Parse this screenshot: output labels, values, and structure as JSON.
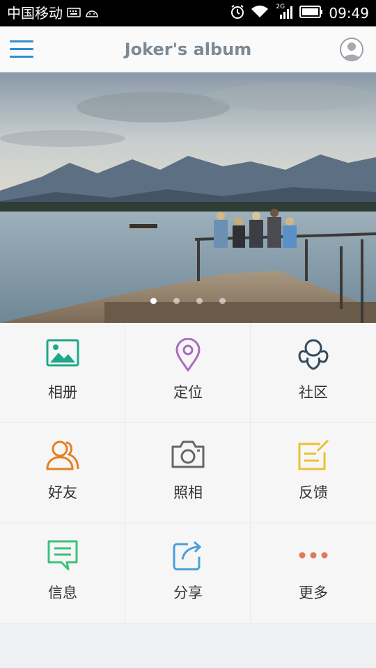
{
  "status_bar": {
    "carrier": "中国移动",
    "network": "2G",
    "time": "09:49"
  },
  "header": {
    "title": "Joker's album",
    "menu_icon": "hamburger-menu-icon",
    "avatar_icon": "user-avatar-icon"
  },
  "banner": {
    "image": "lake-pier-mountains-photo",
    "dots_total": 4,
    "active_dot": 0
  },
  "grid": {
    "items": [
      {
        "label": "相册",
        "icon": "album-icon",
        "color": "#1fa78a"
      },
      {
        "label": "定位",
        "icon": "location-icon",
        "color": "#a86cc1"
      },
      {
        "label": "社区",
        "icon": "community-icon",
        "color": "#34495e"
      },
      {
        "label": "好友",
        "icon": "friends-icon",
        "color": "#e67e22"
      },
      {
        "label": "照相",
        "icon": "camera-icon",
        "color": "#666666"
      },
      {
        "label": "反馈",
        "icon": "feedback-icon",
        "color": "#e9c132"
      },
      {
        "label": "信息",
        "icon": "message-icon",
        "color": "#3cc17a"
      },
      {
        "label": "分享",
        "icon": "share-icon",
        "color": "#4a9fd8"
      },
      {
        "label": "更多",
        "icon": "more-icon",
        "color": "#e0795c"
      }
    ]
  }
}
